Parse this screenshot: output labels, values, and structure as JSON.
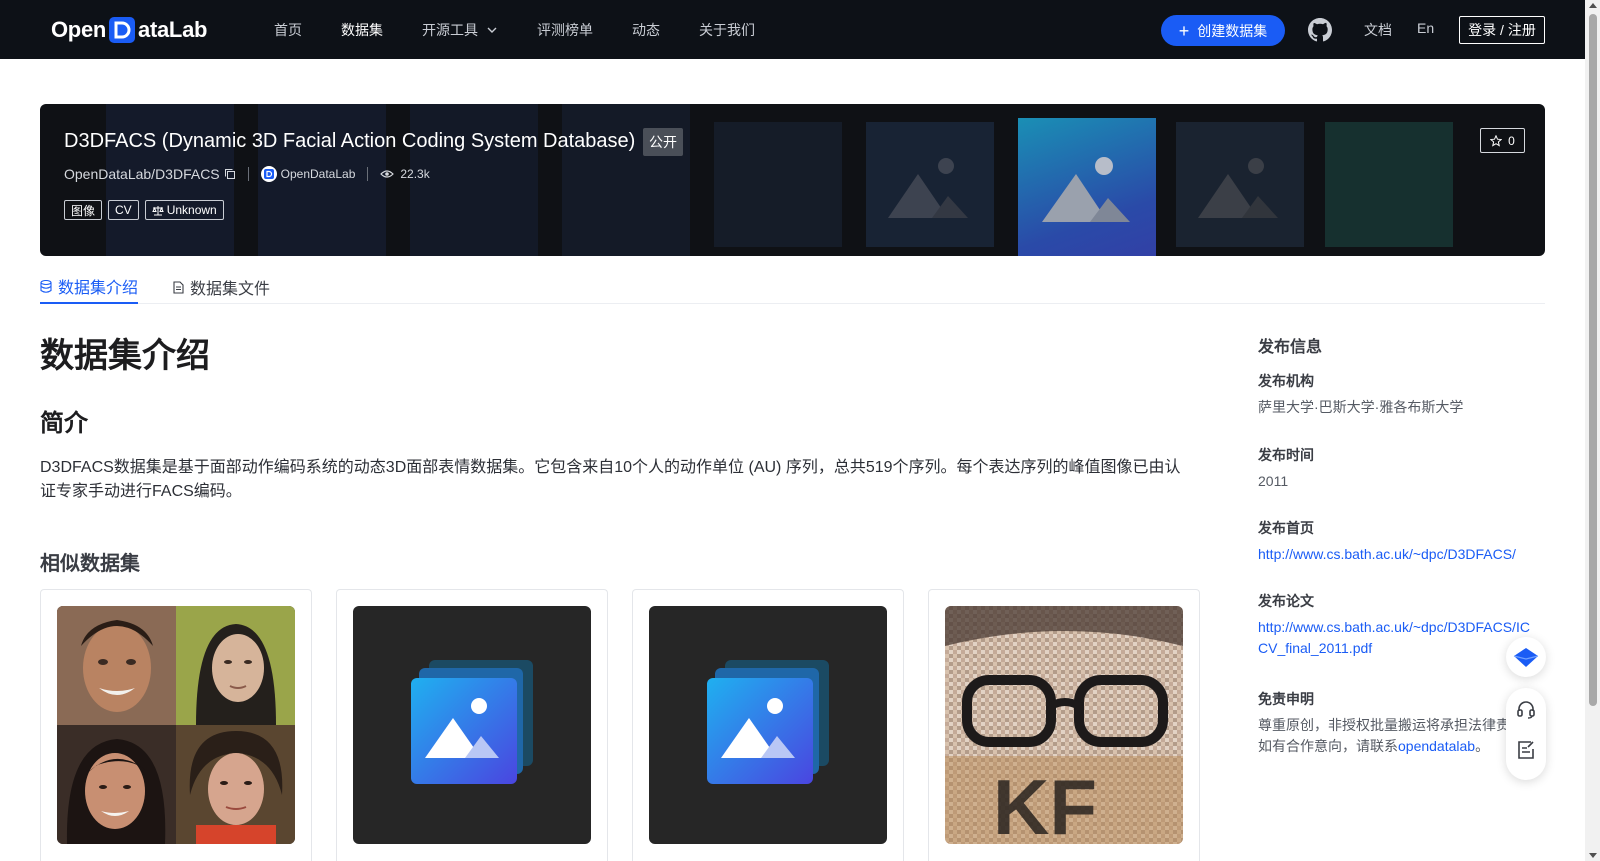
{
  "brand": {
    "logo_left": "Open",
    "logo_right": "ataLab"
  },
  "nav": {
    "items": [
      {
        "label": "首页"
      },
      {
        "label": "数据集"
      },
      {
        "label": "开源工具"
      },
      {
        "label": "评测榜单"
      },
      {
        "label": "动态"
      },
      {
        "label": "关于我们"
      }
    ],
    "create_label": "创建数据集",
    "docs": "文档",
    "lang": "En",
    "login": "登录 / 注册"
  },
  "hero": {
    "title": "D3DFACS (Dynamic 3D Facial Action Coding System Database)",
    "visibility": "公开",
    "repo": "OpenDataLab/D3DFACS",
    "org": "OpenDataLab",
    "views": "22.3k",
    "tags": [
      "图像",
      "CV",
      "Unknown"
    ],
    "stars": "0"
  },
  "tabs": [
    {
      "label": "数据集介绍"
    },
    {
      "label": "数据集文件"
    }
  ],
  "main": {
    "heading": "数据集介绍",
    "intro_heading": "简介",
    "description": "D3DFACS数据集是基于面部动作编码系统的动态3D面部表情数据集。它包含来自10个人的动作单位 (AU) 序列，总共519个序列。每个表达序列的峰值图像已由认证专家手动进行FACS编码。",
    "similar_heading": "相似数据集"
  },
  "sidebar": {
    "title": "发布信息",
    "org_label": "发布机构",
    "org_value": "萨里大学·巴斯大学·雅各布斯大学",
    "time_label": "发布时间",
    "time_value": "2011",
    "home_label": "发布首页",
    "home_value": "http://www.cs.bath.ac.uk/~dpc/D3DFACS/",
    "paper_label": "发布论文",
    "paper_value": "http://www.cs.bath.ac.uk/~dpc/D3DFACS/ICCV_final_2011.pdf",
    "disclaimer_label": "免责申明",
    "disclaimer_line1": "尊重原创，非授权批量搬运将承担法律责",
    "disclaimer_line2": "如有合作意向，请联系",
    "disclaimer_link": "opendatalab",
    "disclaimer_end": "。"
  },
  "colors": {
    "nav_bg": "#0d1117",
    "accent": "#1a5cf5",
    "hero_bg": "#0f1115"
  }
}
